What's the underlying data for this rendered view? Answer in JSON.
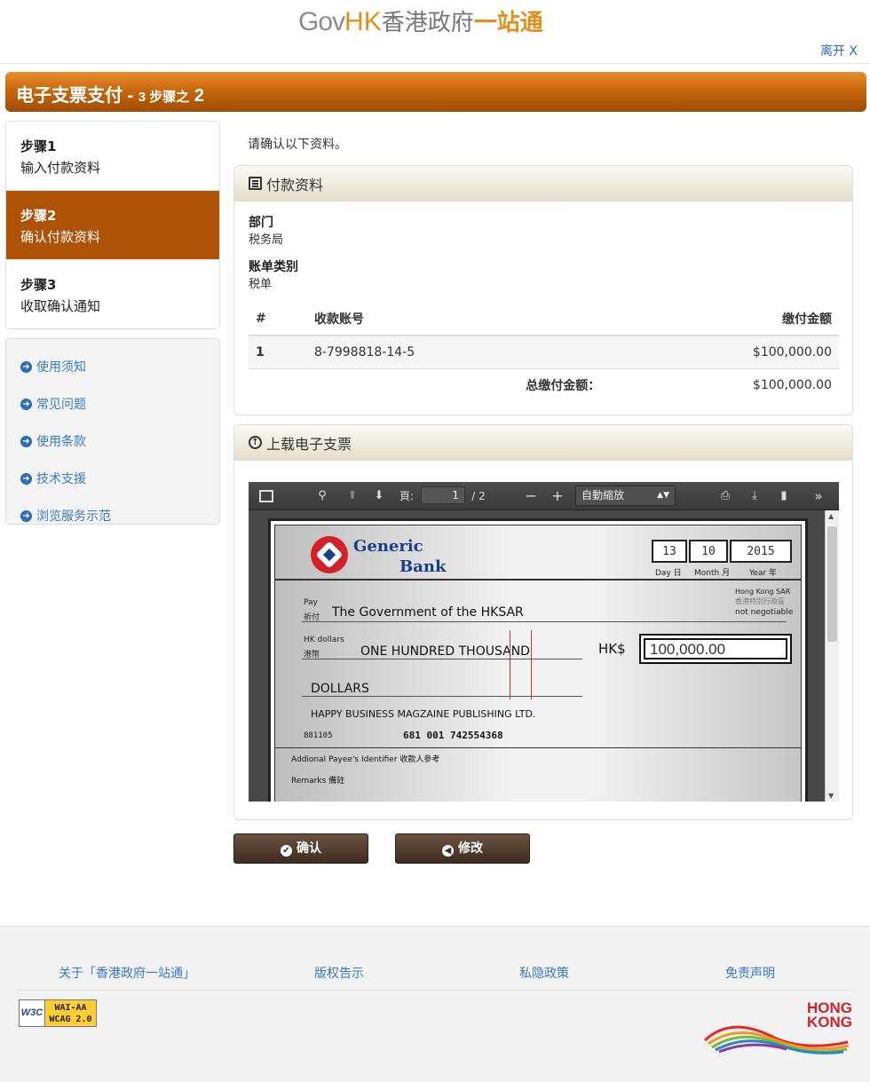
{
  "header": {
    "logo_gov": "Gov",
    "logo_hk": "HK",
    "logo_cn": "香港政府",
    "logo_cn2": "一站通",
    "exit": "离开 X"
  },
  "title": {
    "main": "电子支票支付 - ",
    "step_num": "3",
    "step_of": "步骤之",
    "current": "2"
  },
  "steps": [
    {
      "num": "步骤1",
      "label": "输入付款资料"
    },
    {
      "num": "步骤2",
      "label": "确认付款资料"
    },
    {
      "num": "步骤3",
      "label": "收取确认通知"
    }
  ],
  "side_links": [
    "使用须知",
    "常见问题",
    "使用条款",
    "技术支援",
    "浏览服务示范"
  ],
  "intro": "请确认以下资料。",
  "payment": {
    "heading": "付款资料",
    "dept_label": "部门",
    "dept_value": "税务局",
    "bill_label": "账单类别",
    "bill_value": "税单",
    "col_no": "#",
    "col_account": "收款账号",
    "col_amount": "缴付金额",
    "rows": [
      {
        "no": "1",
        "account": "8-7998818-14-5",
        "amount": "$100,000.00"
      }
    ],
    "total_label": "总缴付金额：",
    "total_value": "$100,000.00"
  },
  "upload": {
    "heading": "上载电子支票",
    "viewer": {
      "page_label": "頁:",
      "page_current": "1",
      "page_total": "/ 2",
      "zoom": "自動縮放"
    },
    "cheque": {
      "bank1": "Generic",
      "bank2": "Bank",
      "day": "13",
      "month": "10",
      "year": "2015",
      "day_lbl": "Day 日",
      "month_lbl": "Month 月",
      "year_lbl": "Year 年",
      "hksar_en": "Hong Kong SAR",
      "hksar_cn": "香港特別行政區",
      "not_negotiable": "not negotiable",
      "pay_en": "Pay",
      "pay_cn": "祈付",
      "payee": "The Government of the HKSAR",
      "hkd_en": "HK dollars",
      "hkd_cn": "港幣",
      "words1": "ONE HUNDRED THOUSAND",
      "words2": "DOLLARS",
      "hk_sign": "HK$",
      "amount": "100,000.00",
      "payer": "HAPPY BUSINESS MAGZAINE PUBLISHING LTD.",
      "micr1": "881105",
      "micr2": "681  001  742554368",
      "addl_payee": "Addional Payee's Identifier 收款人參考",
      "remarks": "Remarks 備註"
    }
  },
  "buttons": {
    "confirm": "确认",
    "modify": "修改"
  },
  "footer": {
    "links": [
      "关于「香港政府一站通」",
      "版权告示",
      "私隐政策",
      "免责声明"
    ],
    "w3c_left": "W3C",
    "w3c_right1": "WAI-AA",
    "w3c_right2": "WCAG 2.0",
    "brand1": "HONG",
    "brand2": "KONG"
  }
}
